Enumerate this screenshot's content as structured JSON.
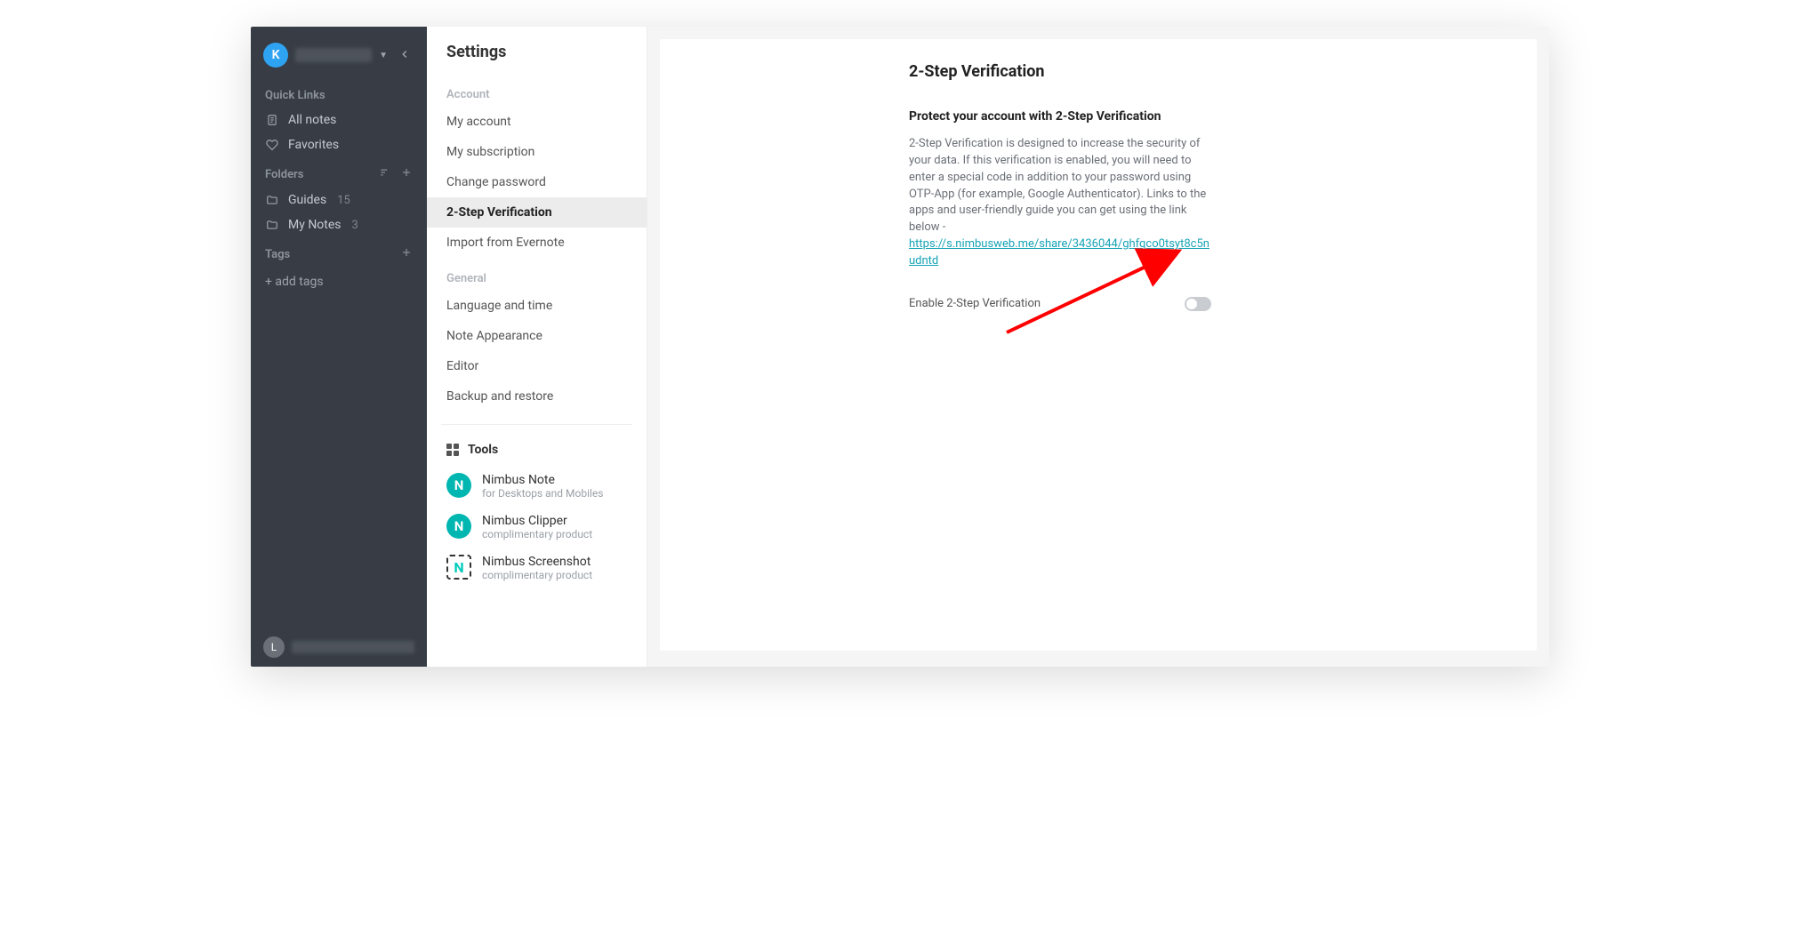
{
  "sidebar": {
    "avatar_letter": "K",
    "quick_links_label": "Quick Links",
    "all_notes_label": "All notes",
    "favorites_label": "Favorites",
    "folders_label": "Folders",
    "folders": [
      {
        "name": "Guides",
        "count": "15"
      },
      {
        "name": "My Notes",
        "count": "3"
      }
    ],
    "tags_label": "Tags",
    "add_tags_label": "+ add tags",
    "bottom_avatar_letter": "L"
  },
  "settings_nav": {
    "title": "Settings",
    "groups": [
      {
        "label": "Account",
        "items": [
          "My account",
          "My subscription",
          "Change password",
          "2-Step Verification",
          "Import from Evernote"
        ],
        "active_index": 3
      },
      {
        "label": "General",
        "items": [
          "Language and time",
          "Note Appearance",
          "Editor",
          "Backup and restore"
        ],
        "active_index": -1
      }
    ],
    "tools_label": "Tools",
    "tools": [
      {
        "title": "Nimbus Note",
        "sub": "for Desktops and Mobiles"
      },
      {
        "title": "Nimbus Clipper",
        "sub": "complimentary product"
      },
      {
        "title": "Nimbus Screenshot",
        "sub": "complimentary product"
      }
    ]
  },
  "content": {
    "h1": "2-Step Verification",
    "subheading": "Protect your account with 2-Step Verification",
    "description": "2-Step Verification is designed to increase the security of your data. If this verification is enabled, you will need to enter a special code in addition to your password using OTP-App (for example, Google Authenticator). Links to the apps and user-friendly guide you can get using the link below -",
    "link_text": "https://s.nimbusweb.me/share/3436044/ghfqco0tsyt8c5nudntd",
    "toggle_label": "Enable 2-Step Verification"
  }
}
